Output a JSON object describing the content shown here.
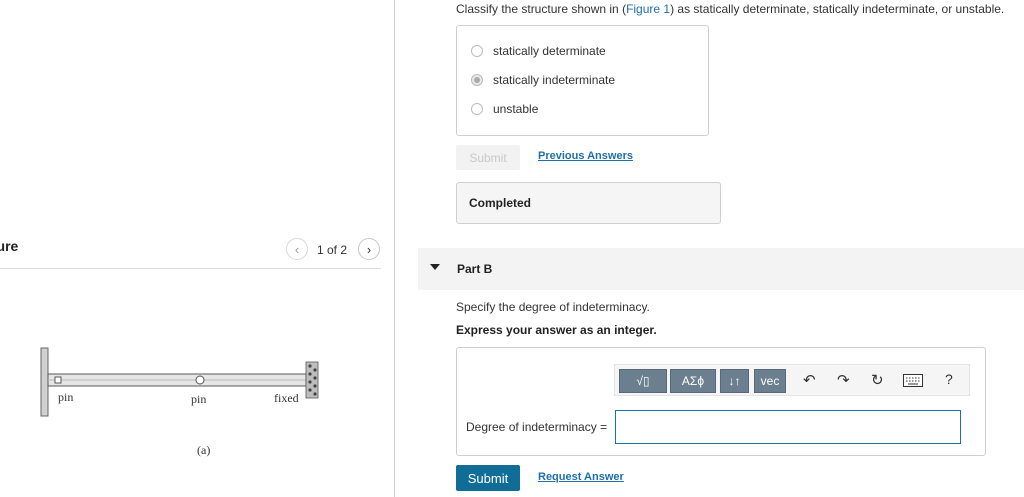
{
  "question": {
    "text_before": "Classify the structure shown in (",
    "figure_link": "Figure 1",
    "text_after": ") as statically determinate, statically indeterminate, or unstable."
  },
  "options": [
    {
      "label": "statically determinate",
      "selected": false
    },
    {
      "label": "statically indeterminate",
      "selected": true
    },
    {
      "label": "unstable",
      "selected": false
    }
  ],
  "part_a": {
    "submit_label": "Submit",
    "previous_answers_label": "Previous Answers",
    "status": "Completed"
  },
  "figure": {
    "title": "gure",
    "page_indicator": "1 of 2",
    "labels": {
      "left_support": "pin",
      "middle_support": "pin",
      "right_support": "fixed",
      "caption": "(a)"
    }
  },
  "part_b": {
    "title": "Part B",
    "prompt": "Specify the degree of indeterminacy.",
    "instruction": "Express your answer as an integer.",
    "toolbar": {
      "templates": "√▯",
      "greek": "AΣϕ",
      "arrows": "↓↑",
      "vec": "vec",
      "help": "?"
    },
    "answer_label": "Degree of indeterminacy =",
    "answer_value": "",
    "submit_label": "Submit",
    "request_answer_label": "Request Answer"
  },
  "colors": {
    "link": "#1e6fa8",
    "submit": "#0f6d97",
    "toolbar_button": "#6b7f8f"
  }
}
